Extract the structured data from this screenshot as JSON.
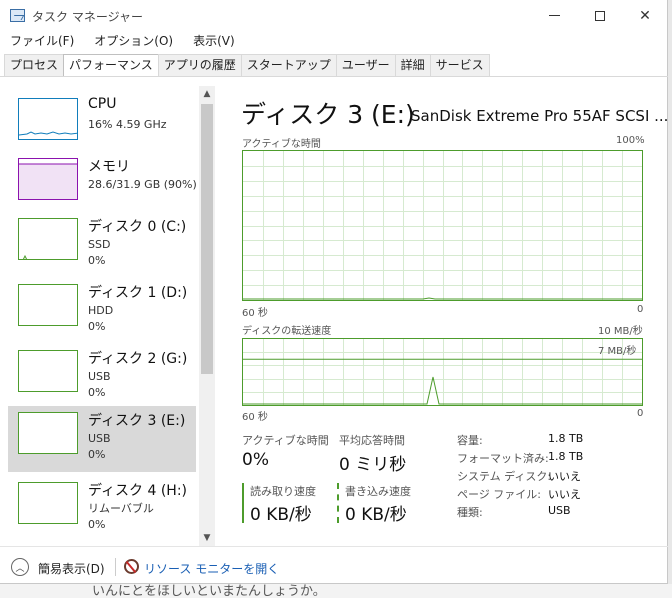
{
  "window": {
    "title": "タスク マネージャー",
    "background_text": "いんにとをほしいといまたんしょうか。"
  },
  "menu": [
    "ファイル(F)",
    "オプション(O)",
    "表示(V)"
  ],
  "tabs": [
    "プロセス",
    "パフォーマンス",
    "アプリの履歴",
    "スタートアップ",
    "ユーザー",
    "詳細",
    "サービス"
  ],
  "active_tab": "パフォーマンス",
  "sidebar": {
    "items": [
      {
        "title": "CPU",
        "line1": "16%  4.59 GHz",
        "line2": "",
        "color": "#117dbb",
        "selected": false
      },
      {
        "title": "メモリ",
        "line1": "28.6/31.9 GB (90%)",
        "line2": "",
        "color": "#8b12ae",
        "selected": false
      },
      {
        "title": "ディスク 0 (C:)",
        "line1": "SSD",
        "line2": "0%",
        "color": "#4d9c2c",
        "selected": false
      },
      {
        "title": "ディスク 1 (D:)",
        "line1": "HDD",
        "line2": "0%",
        "color": "#4d9c2c",
        "selected": false
      },
      {
        "title": "ディスク 2 (G:)",
        "line1": "USB",
        "line2": "0%",
        "color": "#4d9c2c",
        "selected": false
      },
      {
        "title": "ディスク 3 (E:)",
        "line1": "USB",
        "line2": "0%",
        "color": "#4d9c2c",
        "selected": true
      },
      {
        "title": "ディスク 4 (H:)",
        "line1": "リムーバブル",
        "line2": "0%",
        "color": "#4d9c2c",
        "selected": false
      }
    ]
  },
  "main": {
    "title": "ディスク 3 (E:)",
    "model": "SanDisk Extreme Pro 55AF SCSI ...",
    "active_time_graph": {
      "label": "アクティブな時間",
      "max_label": "100%",
      "x_left": "60 秒",
      "x_right": "0"
    },
    "transfer_graph": {
      "label": "ディスクの転送速度",
      "max_label": "10 MB/秒",
      "ref_label": "7 MB/秒",
      "x_left": "60 秒",
      "x_right": "0"
    },
    "stats": {
      "active_time_label": "アクティブな時間",
      "active_time_value": "0%",
      "avg_response_label": "平均応答時間",
      "avg_response_value": "0 ミリ秒",
      "read_label": "読み取り速度",
      "read_value": "0 KB/秒",
      "write_label": "書き込み速度",
      "write_value": "0 KB/秒"
    },
    "properties": [
      {
        "label": "容量:",
        "value": "1.8 TB"
      },
      {
        "label": "フォーマット済み:",
        "value": "1.8 TB"
      },
      {
        "label": "システム ディスク:",
        "value": "いいえ"
      },
      {
        "label": "ページ ファイル:",
        "value": "いいえ"
      },
      {
        "label": "種類:",
        "value": "USB"
      }
    ]
  },
  "footer": {
    "fewer_details": "簡易表示(D)",
    "resource_monitor": "リソース モニターを開く"
  },
  "colors": {
    "disk_green": "#4d9c2c",
    "cpu_blue": "#117dbb",
    "memory_purple": "#8b12ae",
    "link_blue": "#1a5fb4"
  }
}
